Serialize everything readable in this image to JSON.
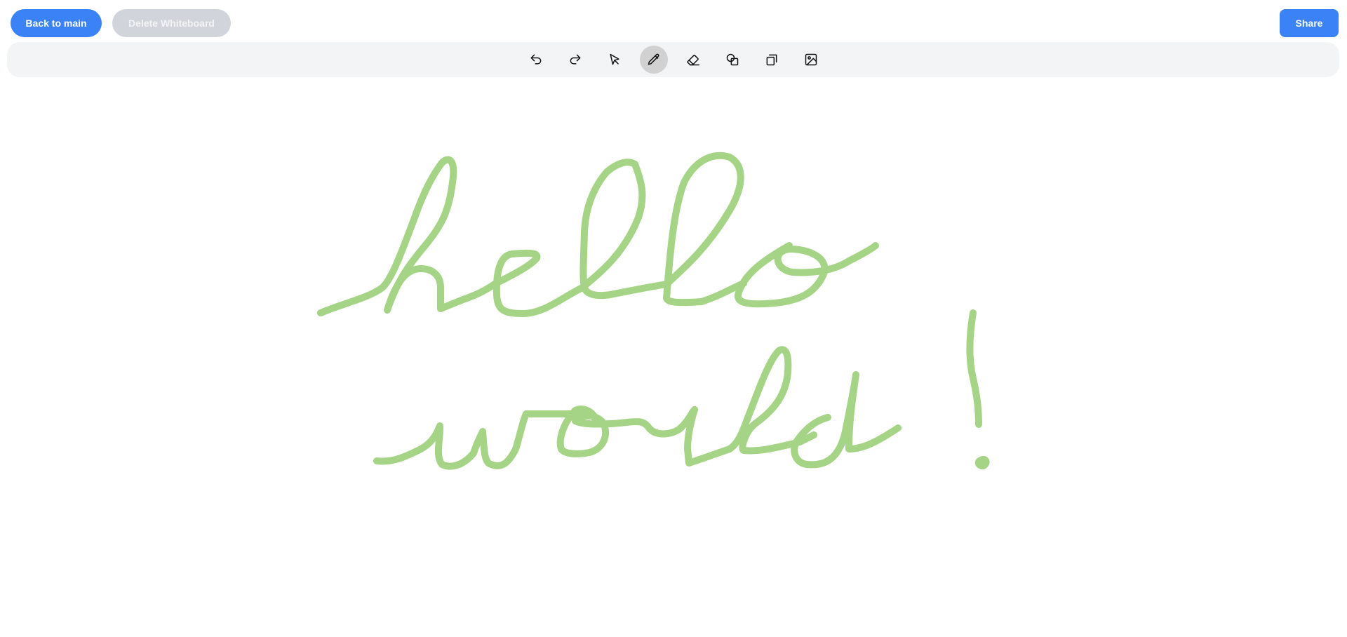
{
  "header": {
    "back_label": "Back to main",
    "delete_label": "Delete Whiteboard",
    "share_label": "Share"
  },
  "toolbar": {
    "tools": [
      {
        "name": "undo",
        "icon": "undo-icon",
        "active": false
      },
      {
        "name": "redo",
        "icon": "redo-icon",
        "active": false
      },
      {
        "name": "select",
        "icon": "cursor-icon",
        "active": false
      },
      {
        "name": "pen",
        "icon": "pencil-icon",
        "active": true
      },
      {
        "name": "eraser",
        "icon": "eraser-icon",
        "active": false
      },
      {
        "name": "shapes",
        "icon": "shapes-icon",
        "active": false
      },
      {
        "name": "copy",
        "icon": "copy-icon",
        "active": false
      },
      {
        "name": "image",
        "icon": "image-icon",
        "active": false
      }
    ]
  },
  "canvas": {
    "stroke_color": "#a5d486"
  },
  "colors": {
    "accent": "#3b82f6",
    "disabled": "#d1d5db",
    "toolbar_bg": "#f3f4f6"
  }
}
